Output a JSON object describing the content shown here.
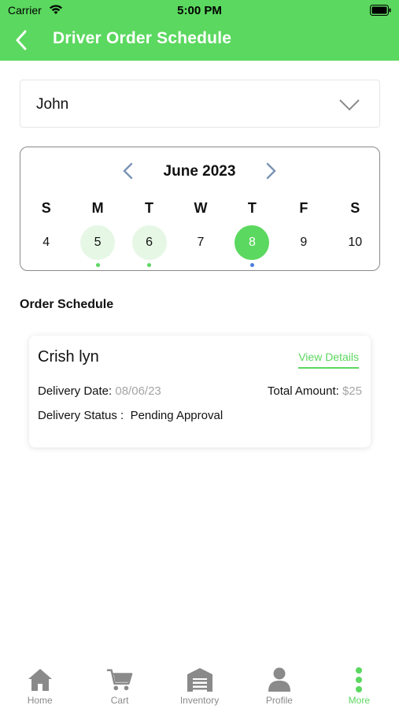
{
  "status_bar": {
    "carrier": "Carrier",
    "time": "5:00 PM"
  },
  "nav": {
    "title": "Driver Order Schedule"
  },
  "driver_select": {
    "value": "John"
  },
  "calendar": {
    "month": "June 2023",
    "days_of_week": [
      "S",
      "M",
      "T",
      "W",
      "T",
      "F",
      "S"
    ],
    "days": [
      {
        "label": "4",
        "state": "normal"
      },
      {
        "label": "5",
        "state": "marked",
        "dot": "#5bd85f"
      },
      {
        "label": "6",
        "state": "marked",
        "dot": "#5bd85f"
      },
      {
        "label": "7",
        "state": "normal"
      },
      {
        "label": "8",
        "state": "selected",
        "dot": "#4a7fe0"
      },
      {
        "label": "9",
        "state": "normal"
      },
      {
        "label": "10",
        "state": "normal"
      }
    ]
  },
  "section": {
    "title": "Order Schedule"
  },
  "order": {
    "customer": "Crish lyn",
    "view_details": "View Details",
    "delivery_date_label": "Delivery Date:",
    "delivery_date": "08/06/23",
    "total_amount_label": "Total Amount:",
    "total_amount": "$25",
    "delivery_status_label": "Delivery Status :",
    "delivery_status": "Pending Approval"
  },
  "tabbar": {
    "tabs": [
      {
        "label": "Home",
        "icon": "home-icon",
        "active": false
      },
      {
        "label": "Cart",
        "icon": "cart-icon",
        "active": false
      },
      {
        "label": "Inventory",
        "icon": "warehouse-icon",
        "active": false
      },
      {
        "label": "Profile",
        "icon": "person-icon",
        "active": false
      },
      {
        "label": "More",
        "icon": "more-vertical-icon",
        "active": true
      }
    ]
  },
  "colors": {
    "accent": "#5bd85f",
    "marked_day_bg": "#e6f7e6",
    "muted_text": "#a5a5a5",
    "tab_inactive": "#8a8a8a",
    "selected_dot": "#4a7fe0"
  }
}
